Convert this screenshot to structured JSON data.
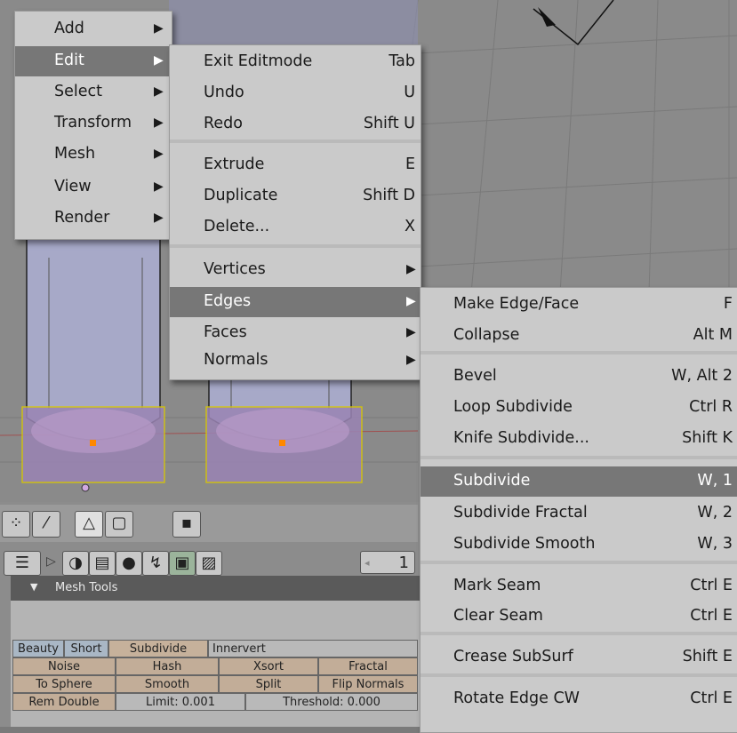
{
  "main_menu": {
    "items": [
      {
        "label": "Add"
      },
      {
        "label": "Edit",
        "highlighted": true
      },
      {
        "label": "Select"
      },
      {
        "label": "Transform"
      },
      {
        "label": "Mesh"
      },
      {
        "label": "View"
      },
      {
        "label": "Render"
      }
    ]
  },
  "edit_menu": {
    "items": [
      {
        "label": "Exit Editmode",
        "shortcut": "Tab"
      },
      {
        "label": "Undo",
        "shortcut": "U"
      },
      {
        "label": "Redo",
        "shortcut": "Shift U"
      },
      {
        "label": "Extrude",
        "shortcut": "E"
      },
      {
        "label": "Duplicate",
        "shortcut": "Shift D"
      },
      {
        "label": "Delete...",
        "shortcut": "X"
      },
      {
        "label": "Vertices"
      },
      {
        "label": "Edges",
        "highlighted": true
      },
      {
        "label": "Faces"
      },
      {
        "label": "Normals"
      }
    ]
  },
  "edges_menu": {
    "items": [
      {
        "label": "Make Edge/Face",
        "shortcut": "F"
      },
      {
        "label": "Collapse",
        "shortcut": "Alt M"
      },
      {
        "label": "Bevel",
        "shortcut": "W, Alt 2"
      },
      {
        "label": "Loop Subdivide",
        "shortcut": "Ctrl R"
      },
      {
        "label": "Knife Subdivide...",
        "shortcut": "Shift K"
      },
      {
        "label": "Subdivide",
        "shortcut": "W, 1",
        "highlighted": true
      },
      {
        "label": "Subdivide Fractal",
        "shortcut": "W, 2"
      },
      {
        "label": "Subdivide Smooth",
        "shortcut": "W, 3"
      },
      {
        "label": "Mark Seam",
        "shortcut": "Ctrl E"
      },
      {
        "label": "Clear Seam",
        "shortcut": "Ctrl E"
      },
      {
        "label": "Crease SubSurf",
        "shortcut": "Shift E"
      },
      {
        "label": "Rotate Edge CW",
        "shortcut": "Ctrl E"
      }
    ]
  },
  "toolbar": {
    "frame_field": "1"
  },
  "mesh_tools": {
    "title": "Mesh Tools",
    "row1": [
      "Beauty",
      "Short",
      "Subdivide",
      "Innervert"
    ],
    "row2": [
      "Noise",
      "Hash",
      "Xsort",
      "Fractal"
    ],
    "row3": [
      "To Sphere",
      "Smooth",
      "Split",
      "Flip Normals"
    ],
    "row4": [
      "Rem Double",
      "Limit: 0.001",
      "Threshold: 0.000"
    ]
  },
  "colors": {
    "menu_bg": "#cacaca",
    "menu_highlight": "#777777",
    "viewport_bg": "#8a8a8a",
    "selection_purple": "#9a84b4"
  }
}
